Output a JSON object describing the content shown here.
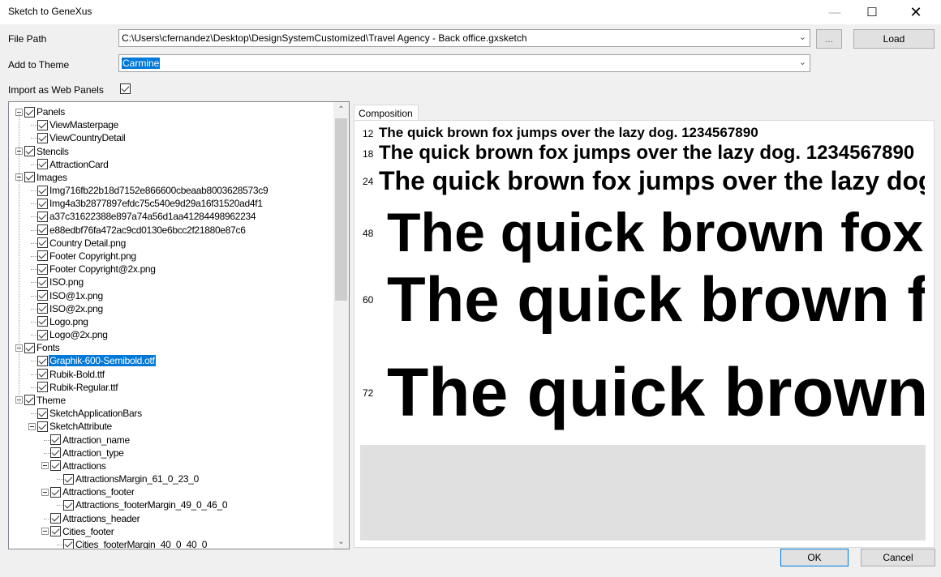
{
  "window": {
    "title": "Sketch to GeneXus",
    "minimize_icon": "minimize-icon",
    "maximize_icon": "maximize-icon",
    "close_icon": "close-icon"
  },
  "form": {
    "file_path_label": "File Path",
    "file_path_value": "C:\\Users\\cfernandez\\Desktop\\DesignSystemCustomized\\Travel Agency - Back office.gxsketch",
    "browse_label": "...",
    "load_label": "Load",
    "theme_label": "Add to Theme",
    "theme_value": "Carmine",
    "import_label": "Import as Web Panels",
    "import_checked": true
  },
  "tree": {
    "items": [
      {
        "label": "Panels"
      },
      {
        "label": "ViewMasterpage"
      },
      {
        "label": "ViewCountryDetail"
      },
      {
        "label": "Stencils"
      },
      {
        "label": "AttractionCard"
      },
      {
        "label": "Images"
      },
      {
        "label": "Img716fb22b18d7152e866600cbeaab8003628573c9"
      },
      {
        "label": "Img4a3b2877897efdc75c540e9d29a16f31520ad4f1"
      },
      {
        "label": "a37c31622388e897a74a56d1aa41284498962234"
      },
      {
        "label": "e88edbf76fa472ac9cd0130e6bcc2f21880e87c6"
      },
      {
        "label": "Country Detail.png"
      },
      {
        "label": "Footer Copyright.png"
      },
      {
        "label": "Footer Copyright@2x.png"
      },
      {
        "label": "ISO.png"
      },
      {
        "label": "ISO@1x.png"
      },
      {
        "label": "ISO@2x.png"
      },
      {
        "label": "Logo.png"
      },
      {
        "label": "Logo@2x.png"
      },
      {
        "label": "Fonts"
      },
      {
        "label": "Graphik-600-Semibold.otf"
      },
      {
        "label": "Rubik-Bold.ttf"
      },
      {
        "label": "Rubik-Regular.ttf"
      },
      {
        "label": "Theme"
      },
      {
        "label": "SketchApplicationBars"
      },
      {
        "label": "SketchAttribute"
      },
      {
        "label": "Attraction_name"
      },
      {
        "label": "Attraction_type"
      },
      {
        "label": "Attractions"
      },
      {
        "label": "AttractionsMargin_61_0_23_0"
      },
      {
        "label": "Attractions_footer"
      },
      {
        "label": "Attractions_footerMargin_49_0_46_0"
      },
      {
        "label": "Attractions_header"
      },
      {
        "label": "Cities_footer"
      },
      {
        "label": "Cities_footerMargin_40_0_40_0"
      }
    ]
  },
  "composition": {
    "tab_label": "Composition",
    "sample_text": "The quick brown fox jumps over the lazy dog. 1234567890",
    "sizes": [
      "12",
      "18",
      "24",
      "48",
      "60",
      "72"
    ]
  },
  "footer": {
    "ok_label": "OK",
    "cancel_label": "Cancel"
  }
}
